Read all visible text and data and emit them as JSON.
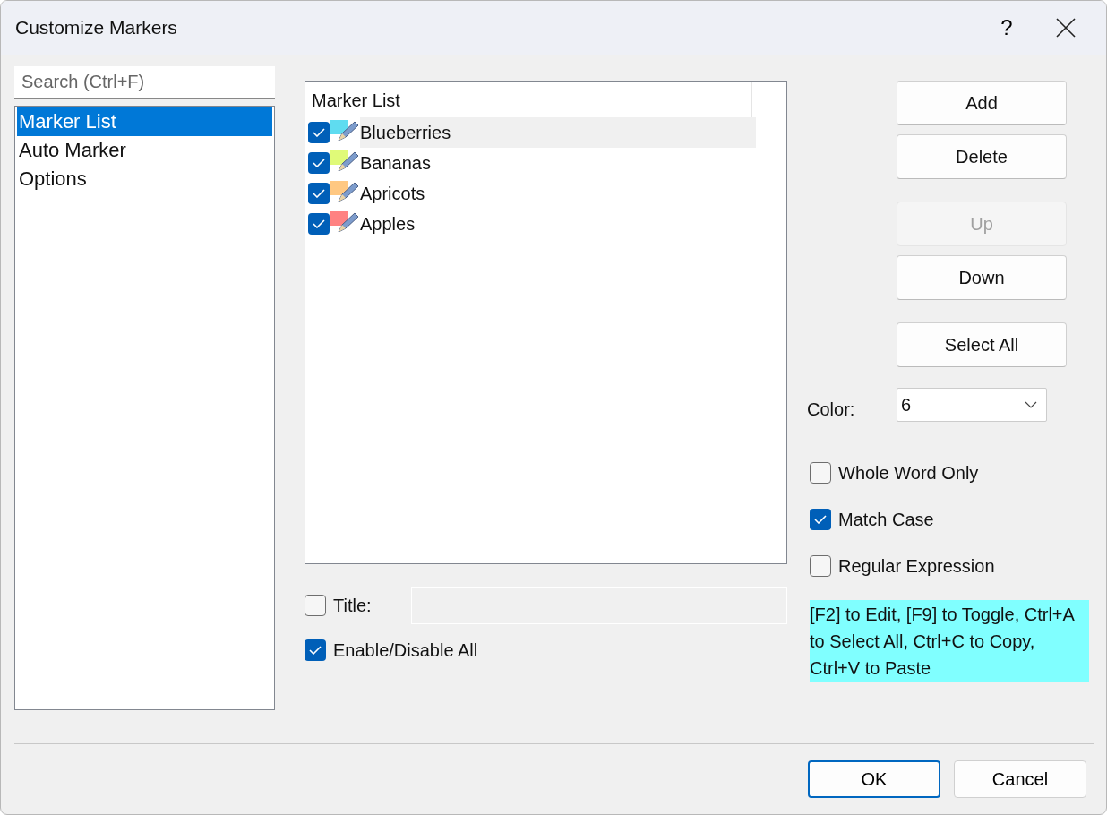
{
  "window": {
    "title": "Customize Markers",
    "help": "?"
  },
  "search": {
    "placeholder": "Search (Ctrl+F)"
  },
  "nav": [
    {
      "label": "Marker List",
      "selected": true
    },
    {
      "label": "Auto Marker",
      "selected": false
    },
    {
      "label": "Options",
      "selected": false
    }
  ],
  "marker_list": {
    "header": "Marker List",
    "items": [
      {
        "label": "Blueberries",
        "checked": true,
        "selected": true,
        "color": "#5fdcf0"
      },
      {
        "label": "Bananas",
        "checked": true,
        "selected": false,
        "color": "#e0fa78"
      },
      {
        "label": "Apricots",
        "checked": true,
        "selected": false,
        "color": "#ffc882"
      },
      {
        "label": "Apples",
        "checked": true,
        "selected": false,
        "color": "#ff8282"
      }
    ]
  },
  "title_option": {
    "label": "Title:",
    "checked": false
  },
  "enable_all": {
    "label": "Enable/Disable All",
    "checked": true
  },
  "side_buttons": [
    {
      "label": "Add",
      "disabled": false
    },
    {
      "label": "Delete",
      "disabled": false
    },
    {
      "label": "Up",
      "disabled": true
    },
    {
      "label": "Down",
      "disabled": false
    },
    {
      "label": "Select All",
      "disabled": false
    }
  ],
  "color": {
    "label": "Color:",
    "value": "6"
  },
  "options": [
    {
      "label": "Whole Word Only",
      "checked": false
    },
    {
      "label": "Match Case",
      "checked": true
    },
    {
      "label": "Regular Expression",
      "checked": false
    }
  ],
  "hint": "[F2] to Edit, [F9] to Toggle, Ctrl+A to Select All, Ctrl+C to Copy, Ctrl+V to Paste",
  "footer_buttons": [
    {
      "label": "OK",
      "default": true
    },
    {
      "label": "Cancel",
      "default": false
    }
  ]
}
